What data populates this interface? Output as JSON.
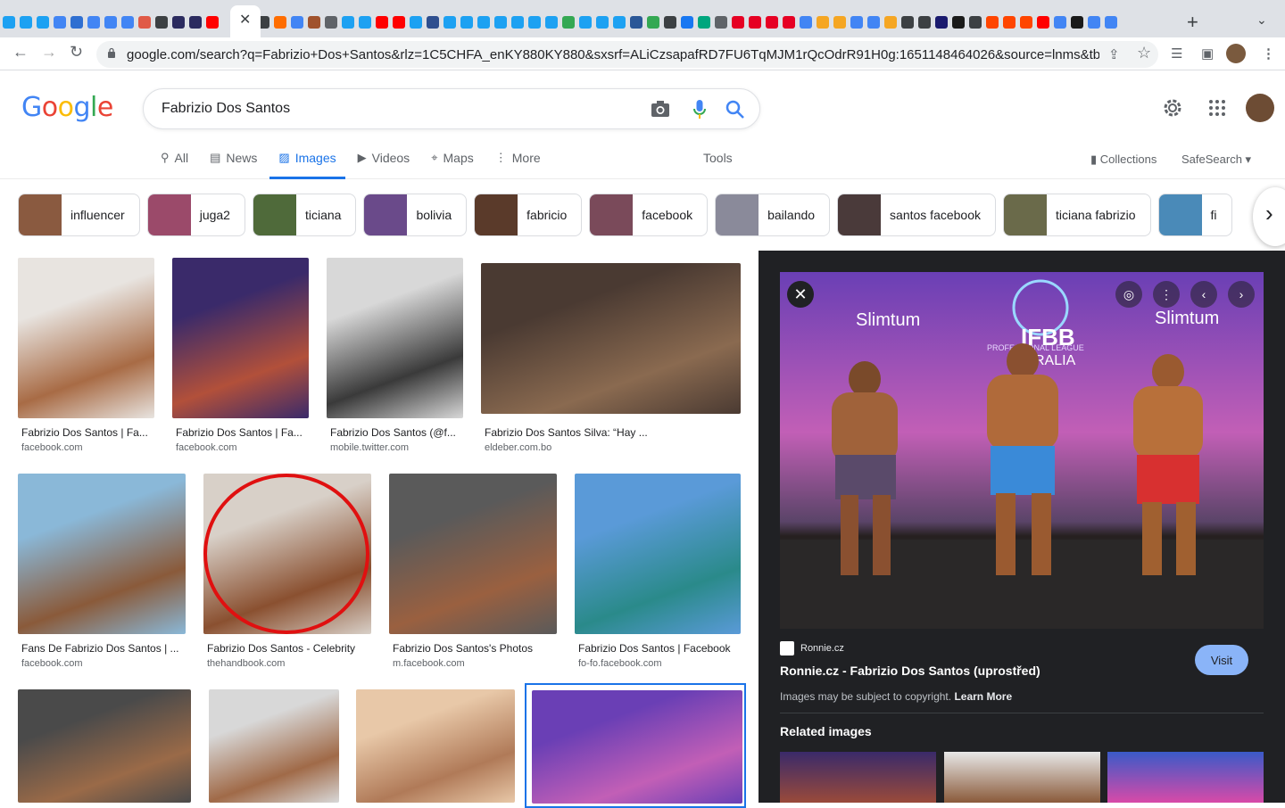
{
  "browser": {
    "url": "google.com/search?q=Fabrizio+Dos+Santos&rlz=1C5CHFA_enKY880KY880&sxsrf=ALiCzsapafRD7FU6TqMJM1rQcOdrR91H0g:1651148464026&source=lnms&tbm=i...",
    "favicon_colors": [
      "#1da1f2",
      "#1da1f2",
      "#1da1f2",
      "#4285f4",
      "#2f6fd1",
      "#4285f4",
      "#4285f4",
      "#4285f4",
      "#e05a47",
      "#3c4043",
      "#2b2b5f",
      "#2b2b5f",
      "#ff0000",
      "#3c4043",
      "#ff6d00",
      "#4285f4",
      "#a0522d",
      "#5f6368",
      "#1da1f2",
      "#1da1f2",
      "#ff0000",
      "#ff0000",
      "#1da1f2",
      "#2f4f8f",
      "#1da1f2",
      "#1da1f2",
      "#1da1f2",
      "#1da1f2",
      "#1da1f2",
      "#1da1f2",
      "#1da1f2",
      "#34a853",
      "#1da1f2",
      "#1da1f2",
      "#1da1f2",
      "#2b5797",
      "#34a853",
      "#3c4043",
      "#1877f2",
      "#00a67e",
      "#5f6368",
      "#e60023",
      "#e60023",
      "#e60023",
      "#e60023",
      "#4285f4",
      "#f5a623",
      "#f5a623",
      "#4285f4",
      "#4285f4",
      "#f5a623",
      "#3c4043",
      "#3c4043",
      "#1a1a6e",
      "#1a1a1a",
      "#3c4043",
      "#ff4500",
      "#ff4500",
      "#ff4500",
      "#ff0000",
      "#4285f4",
      "#1a1a1a",
      "#4285f4",
      "#4285f4"
    ]
  },
  "search": {
    "query": "Fabrizio Dos Santos",
    "logo_letters": [
      "G",
      "o",
      "o",
      "g",
      "l",
      "e"
    ]
  },
  "nav": {
    "tabs": [
      {
        "label": "All",
        "icon": "search-icon"
      },
      {
        "label": "News",
        "icon": "news-icon"
      },
      {
        "label": "Images",
        "icon": "image-icon"
      },
      {
        "label": "Videos",
        "icon": "video-icon"
      },
      {
        "label": "Maps",
        "icon": "map-pin-icon"
      },
      {
        "label": "More",
        "icon": "more-vert-icon"
      }
    ],
    "tools": "Tools",
    "collections": "Collections",
    "safesearch": "SafeSearch"
  },
  "chips": [
    {
      "label": "influencer",
      "color": "#8a5a40"
    },
    {
      "label": "juga2",
      "color": "#9b4a6a"
    },
    {
      "label": "ticiana",
      "color": "#4f6a3a"
    },
    {
      "label": "bolivia",
      "color": "#6a4a8a"
    },
    {
      "label": "fabricio",
      "color": "#5a3a2a"
    },
    {
      "label": "facebook",
      "color": "#7a4a5a"
    },
    {
      "label": "bailando",
      "color": "#8a8a9a"
    },
    {
      "label": "santos facebook",
      "color": "#4a3a3a"
    },
    {
      "label": "ticiana fabrizio",
      "color": "#6a6a4a"
    },
    {
      "label": "fi",
      "color": "#4a8ab8"
    }
  ],
  "results": [
    {
      "title": "Fabrizio Dos Santos | Fa...",
      "source": "facebook.com",
      "colors": [
        "#e8e4e0",
        "#a86b45"
      ]
    },
    {
      "title": "Fabrizio Dos Santos | Fa...",
      "source": "facebook.com",
      "colors": [
        "#3a2a6a",
        "#b2503a"
      ]
    },
    {
      "title": "Fabrizio Dos Santos (@f...",
      "source": "mobile.twitter.com",
      "colors": [
        "#d8d8d8",
        "#3a3a3a"
      ]
    },
    {
      "title": "Fabrizio Dos Santos Silva: “Hay ...",
      "source": "eldeber.com.bo",
      "colors": [
        "#4a3a32",
        "#8a6a50"
      ]
    },
    {
      "title": "Fans De Fabrizio Dos Santos | ...",
      "source": "facebook.com",
      "colors": [
        "#8ab8d8",
        "#8a5a3a"
      ]
    },
    {
      "title": "Fabrizio Dos Santos - Celebrity",
      "source": "thehandbook.com",
      "colors": [
        "#d8d0c8",
        "#8a5030"
      ]
    },
    {
      "title": "Fabrizio Dos Santos's Photos",
      "source": "m.facebook.com",
      "colors": [
        "#5a5a5a",
        "#9a6040"
      ]
    },
    {
      "title": "Fabrizio Dos Santos | Facebook",
      "source": "fo-fo.facebook.com",
      "colors": [
        "#5a9ad8",
        "#2a8a8a"
      ]
    },
    {
      "title": "",
      "source": "",
      "colors": [
        "#4a4a4a",
        "#9a6a48"
      ]
    },
    {
      "title": "",
      "source": "",
      "colors": [
        "#d8d8d8",
        "#a06a48"
      ]
    },
    {
      "title": "",
      "source": "",
      "colors": [
        "#e8c8a8",
        "#b07a58"
      ]
    },
    {
      "title": "",
      "source": "",
      "colors": [
        "#6a3fb5",
        "#c25fb6"
      ]
    }
  ],
  "panel": {
    "source_name": "Ronnie.cz",
    "title": "Ronnie.cz - Fabrizio Dos Santos (uprostřed)",
    "copyright": "Images may be subject to copyright.",
    "learn_more": "Learn More",
    "visit": "Visit",
    "related": "Related images",
    "image_text": {
      "brand_left": "Slimtum",
      "brand_right": "Slimtum",
      "ifbb": "IFBB",
      "league": "PROFESSIONAL LEAGUE",
      "region": "RALIA"
    },
    "related_colors": [
      [
        "#3a2a6a",
        "#9a4a3a"
      ],
      [
        "#e8e8e8",
        "#8a5a3a"
      ],
      [
        "#3a5ac8",
        "#d84aa8"
      ]
    ]
  }
}
